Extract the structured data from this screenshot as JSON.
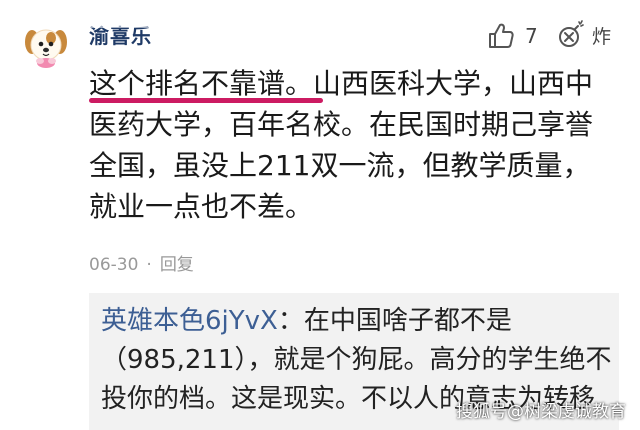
{
  "comment": {
    "username": "渝喜乐",
    "likes": "7",
    "bomb_label": "炸",
    "lines": [
      "这个排名不靠谱。山西医科大学，山西中",
      "医药大学，百年名校。在民国时期己享誉",
      "全国，虽没上211双一流，但教学质量，",
      "就业一点也不差。"
    ],
    "date": "06-30",
    "reply_label": "回复"
  },
  "reply": {
    "username": "英雄本色6jYvX",
    "separator": "：",
    "lines": [
      "在中国啥子都不是",
      "（985,211），就是个狗屁。高分的学生绝不",
      "投你的档。这是现实。不以人的意志为转移"
    ]
  },
  "watermark": "搜狐号@树梁虔诚教育",
  "colors": {
    "highlight_underline": "#cc1b62",
    "reply_username": "#3d5f94",
    "reply_background": "#f2f2f2",
    "meta_text": "#999999"
  },
  "icons": {
    "avatar": "dog-avatar-icon",
    "like": "thumbs-up-icon",
    "bomb": "bomb-icon"
  }
}
